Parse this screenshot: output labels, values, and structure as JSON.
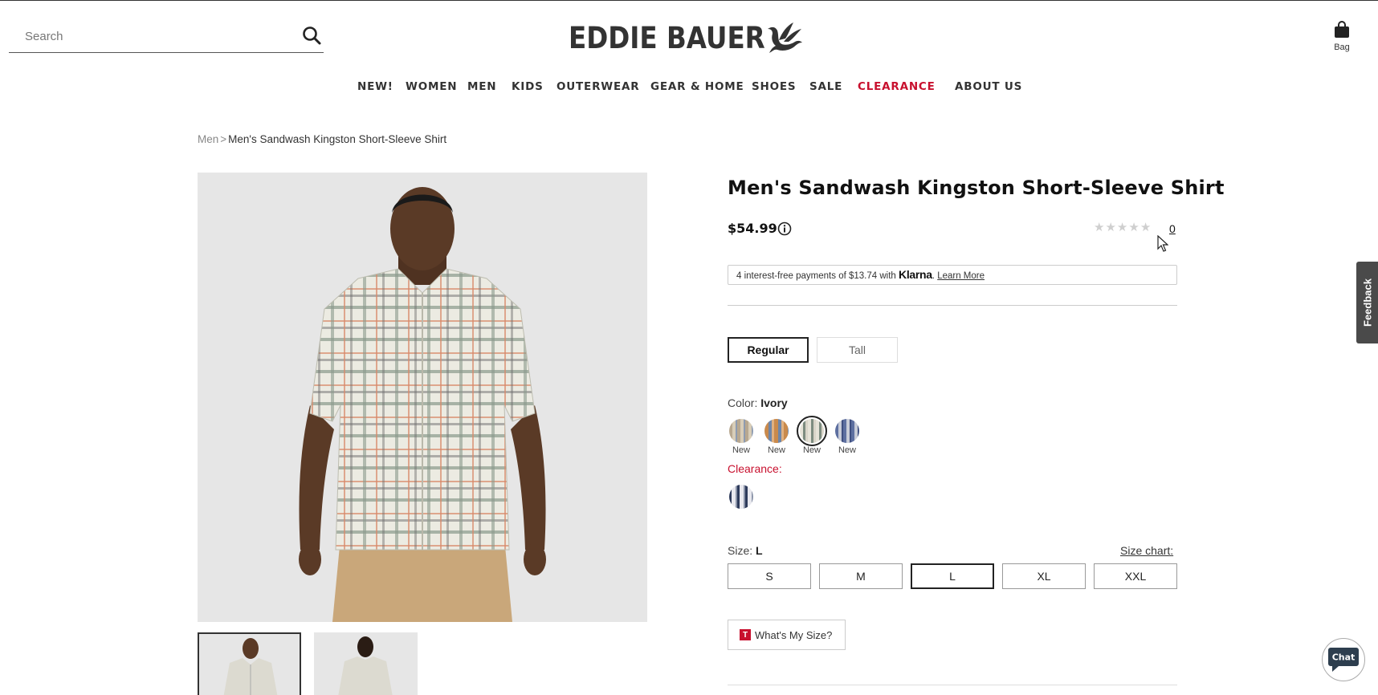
{
  "header": {
    "search_placeholder": "Search",
    "brand": "EDDIE BAUER",
    "bag_label": "Bag"
  },
  "nav": {
    "items": [
      "NEW!",
      "WOMEN",
      "MEN",
      "KIDS",
      "OUTERWEAR",
      "GEAR & HOME",
      "SHOES",
      "SALE",
      "CLEARANCE",
      "ABOUT US"
    ]
  },
  "breadcrumb": {
    "parent": "Men",
    "separator": ">",
    "current": "Men's Sandwash Kingston Short-Sleeve Shirt"
  },
  "product": {
    "title": "Men's Sandwash Kingston Short-Sleeve Shirt",
    "price": "$54.99",
    "rating_stars": 0,
    "review_count": "0",
    "klarna": {
      "text": "4 interest-free payments of $13.74 with",
      "brand": "Klarna",
      "period": ".",
      "learn_more": "Learn More"
    },
    "fits": [
      "Regular",
      "Tall"
    ],
    "selected_fit": "Regular",
    "color_prefix": "Color:",
    "selected_color": "Ivory",
    "swatch_badges": [
      "New",
      "New",
      "New",
      "New"
    ],
    "clearance_label": "Clearance:",
    "size_prefix": "Size:",
    "selected_size": "L",
    "size_chart": "Size chart:",
    "sizes": [
      "S",
      "M",
      "L",
      "XL",
      "XXL"
    ],
    "whats_my_size": "What's My Size?",
    "whats_my_size_badge": "T"
  },
  "widgets": {
    "feedback": "Feedback",
    "chat": "Chat"
  },
  "colors": {
    "clearance_red": "#c8102e",
    "text_dark": "#222222",
    "image_bg": "#e6e6e6"
  }
}
